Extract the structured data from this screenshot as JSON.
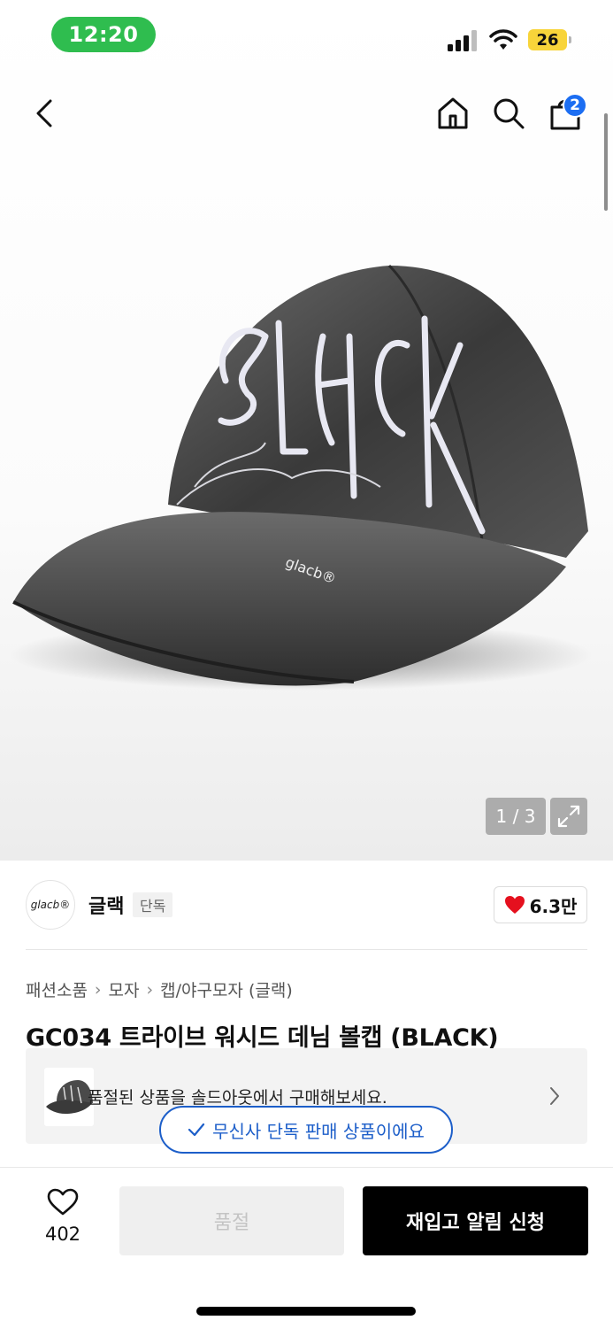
{
  "status_bar": {
    "time": "12:20",
    "battery": "26"
  },
  "nav": {
    "cart_count": "2"
  },
  "gallery": {
    "counter": "1 / 3"
  },
  "brand": {
    "logo_text": "glacb®",
    "name": "글랙",
    "tag": "단독",
    "likes": "6.3만"
  },
  "breadcrumb": [
    "패션소품",
    "모자",
    "캡/야구모자 (글랙)"
  ],
  "product": {
    "title": "GC034 트라이브 워시드 데님 볼캡 (BLACK)"
  },
  "soldout_notice": {
    "text": "품절된 상품을 솔드아웃에서 구매해보세요."
  },
  "exclusive_badge": {
    "text": "무신사 단독 판매 상품이에요"
  },
  "bottom_bar": {
    "wish_count": "402",
    "soldout_label": "품절",
    "restock_label": "재입고 알림 신청"
  },
  "colors": {
    "accent_blue": "#1c6ef2",
    "badge_blue": "#1c5ec9",
    "status_green": "#2fbd4f",
    "heart_red": "#e5101e"
  }
}
